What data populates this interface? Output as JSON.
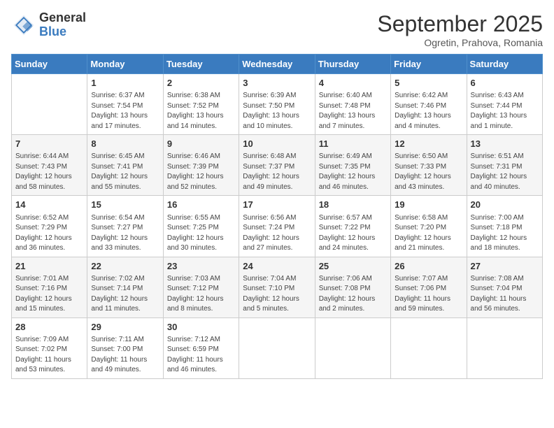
{
  "logo": {
    "general": "General",
    "blue": "Blue"
  },
  "title": "September 2025",
  "subtitle": "Ogretin, Prahova, Romania",
  "days_of_week": [
    "Sunday",
    "Monday",
    "Tuesday",
    "Wednesday",
    "Thursday",
    "Friday",
    "Saturday"
  ],
  "weeks": [
    [
      {
        "day": "",
        "info": ""
      },
      {
        "day": "1",
        "info": "Sunrise: 6:37 AM\nSunset: 7:54 PM\nDaylight: 13 hours\nand 17 minutes."
      },
      {
        "day": "2",
        "info": "Sunrise: 6:38 AM\nSunset: 7:52 PM\nDaylight: 13 hours\nand 14 minutes."
      },
      {
        "day": "3",
        "info": "Sunrise: 6:39 AM\nSunset: 7:50 PM\nDaylight: 13 hours\nand 10 minutes."
      },
      {
        "day": "4",
        "info": "Sunrise: 6:40 AM\nSunset: 7:48 PM\nDaylight: 13 hours\nand 7 minutes."
      },
      {
        "day": "5",
        "info": "Sunrise: 6:42 AM\nSunset: 7:46 PM\nDaylight: 13 hours\nand 4 minutes."
      },
      {
        "day": "6",
        "info": "Sunrise: 6:43 AM\nSunset: 7:44 PM\nDaylight: 13 hours\nand 1 minute."
      }
    ],
    [
      {
        "day": "7",
        "info": "Sunrise: 6:44 AM\nSunset: 7:43 PM\nDaylight: 12 hours\nand 58 minutes."
      },
      {
        "day": "8",
        "info": "Sunrise: 6:45 AM\nSunset: 7:41 PM\nDaylight: 12 hours\nand 55 minutes."
      },
      {
        "day": "9",
        "info": "Sunrise: 6:46 AM\nSunset: 7:39 PM\nDaylight: 12 hours\nand 52 minutes."
      },
      {
        "day": "10",
        "info": "Sunrise: 6:48 AM\nSunset: 7:37 PM\nDaylight: 12 hours\nand 49 minutes."
      },
      {
        "day": "11",
        "info": "Sunrise: 6:49 AM\nSunset: 7:35 PM\nDaylight: 12 hours\nand 46 minutes."
      },
      {
        "day": "12",
        "info": "Sunrise: 6:50 AM\nSunset: 7:33 PM\nDaylight: 12 hours\nand 43 minutes."
      },
      {
        "day": "13",
        "info": "Sunrise: 6:51 AM\nSunset: 7:31 PM\nDaylight: 12 hours\nand 40 minutes."
      }
    ],
    [
      {
        "day": "14",
        "info": "Sunrise: 6:52 AM\nSunset: 7:29 PM\nDaylight: 12 hours\nand 36 minutes."
      },
      {
        "day": "15",
        "info": "Sunrise: 6:54 AM\nSunset: 7:27 PM\nDaylight: 12 hours\nand 33 minutes."
      },
      {
        "day": "16",
        "info": "Sunrise: 6:55 AM\nSunset: 7:25 PM\nDaylight: 12 hours\nand 30 minutes."
      },
      {
        "day": "17",
        "info": "Sunrise: 6:56 AM\nSunset: 7:24 PM\nDaylight: 12 hours\nand 27 minutes."
      },
      {
        "day": "18",
        "info": "Sunrise: 6:57 AM\nSunset: 7:22 PM\nDaylight: 12 hours\nand 24 minutes."
      },
      {
        "day": "19",
        "info": "Sunrise: 6:58 AM\nSunset: 7:20 PM\nDaylight: 12 hours\nand 21 minutes."
      },
      {
        "day": "20",
        "info": "Sunrise: 7:00 AM\nSunset: 7:18 PM\nDaylight: 12 hours\nand 18 minutes."
      }
    ],
    [
      {
        "day": "21",
        "info": "Sunrise: 7:01 AM\nSunset: 7:16 PM\nDaylight: 12 hours\nand 15 minutes."
      },
      {
        "day": "22",
        "info": "Sunrise: 7:02 AM\nSunset: 7:14 PM\nDaylight: 12 hours\nand 11 minutes."
      },
      {
        "day": "23",
        "info": "Sunrise: 7:03 AM\nSunset: 7:12 PM\nDaylight: 12 hours\nand 8 minutes."
      },
      {
        "day": "24",
        "info": "Sunrise: 7:04 AM\nSunset: 7:10 PM\nDaylight: 12 hours\nand 5 minutes."
      },
      {
        "day": "25",
        "info": "Sunrise: 7:06 AM\nSunset: 7:08 PM\nDaylight: 12 hours\nand 2 minutes."
      },
      {
        "day": "26",
        "info": "Sunrise: 7:07 AM\nSunset: 7:06 PM\nDaylight: 11 hours\nand 59 minutes."
      },
      {
        "day": "27",
        "info": "Sunrise: 7:08 AM\nSunset: 7:04 PM\nDaylight: 11 hours\nand 56 minutes."
      }
    ],
    [
      {
        "day": "28",
        "info": "Sunrise: 7:09 AM\nSunset: 7:02 PM\nDaylight: 11 hours\nand 53 minutes."
      },
      {
        "day": "29",
        "info": "Sunrise: 7:11 AM\nSunset: 7:00 PM\nDaylight: 11 hours\nand 49 minutes."
      },
      {
        "day": "30",
        "info": "Sunrise: 7:12 AM\nSunset: 6:59 PM\nDaylight: 11 hours\nand 46 minutes."
      },
      {
        "day": "",
        "info": ""
      },
      {
        "day": "",
        "info": ""
      },
      {
        "day": "",
        "info": ""
      },
      {
        "day": "",
        "info": ""
      }
    ]
  ]
}
